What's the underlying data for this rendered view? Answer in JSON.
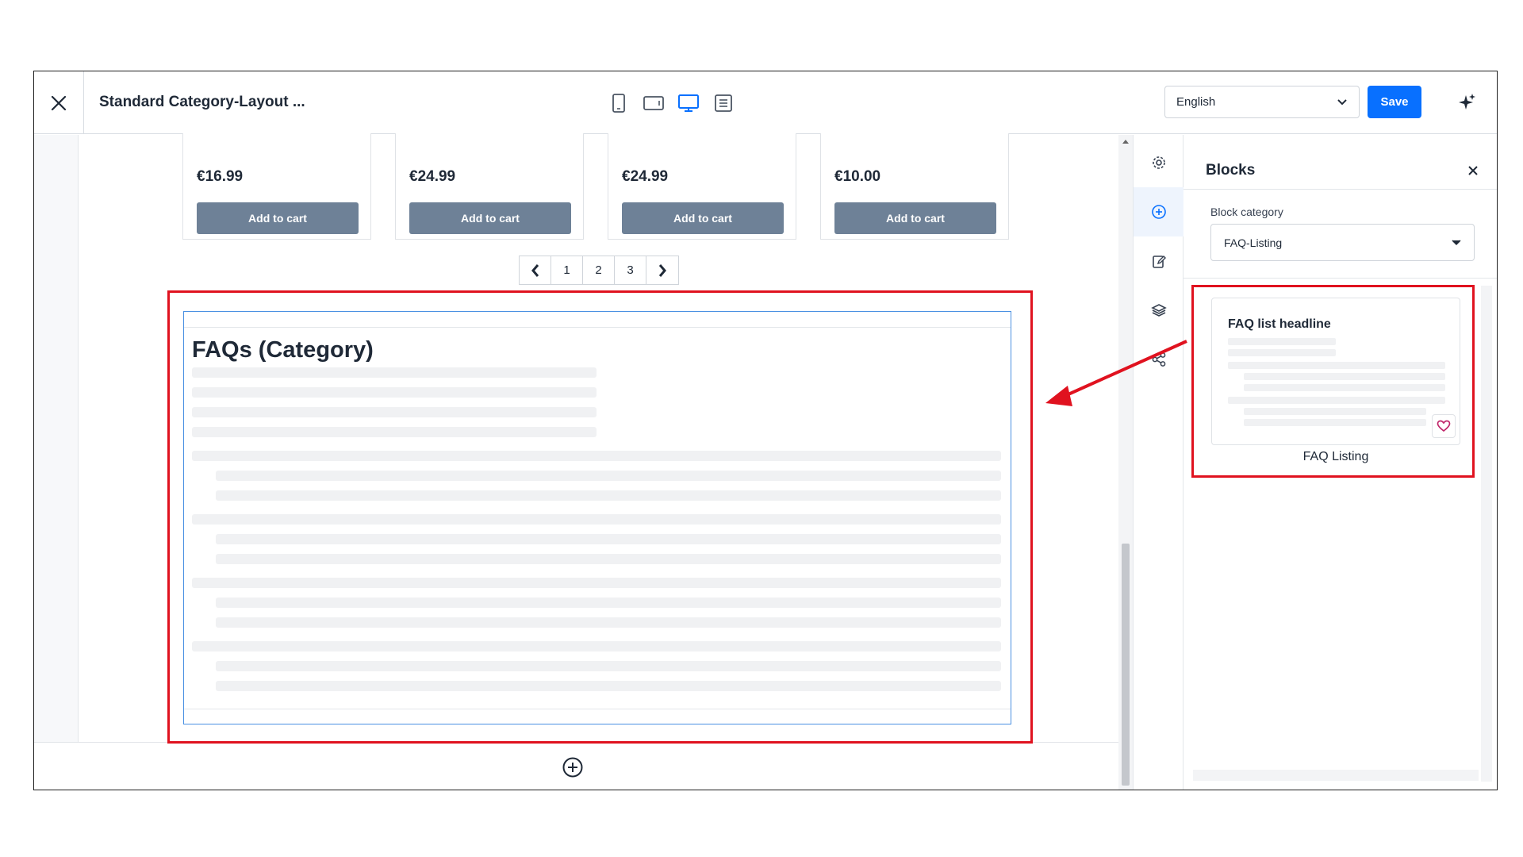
{
  "header": {
    "title": "Standard Category-Layout ...",
    "language": "English",
    "save_label": "Save"
  },
  "products": [
    {
      "price": "€16.99",
      "button": "Add to cart"
    },
    {
      "price": "€24.99",
      "button": "Add to cart"
    },
    {
      "price": "€24.99",
      "button": "Add to cart"
    },
    {
      "price": "€10.00",
      "button": "Add to cart"
    }
  ],
  "pagination": {
    "pages": [
      "1",
      "2",
      "3"
    ]
  },
  "faq_block": {
    "title": "FAQs (Category)"
  },
  "panel": {
    "title": "Blocks",
    "category_label": "Block category",
    "category_value": "FAQ-Listing",
    "card": {
      "headline": "FAQ list headline",
      "label": "FAQ Listing"
    }
  },
  "colors": {
    "accent": "#0870ff",
    "cart_button": "#6e8197",
    "annotation": "#e0121f",
    "selection": "#4a90e2"
  },
  "icons": {
    "header": [
      "close-icon",
      "mobile-icon",
      "tablet-icon",
      "desktop-icon",
      "list-view-icon",
      "chevron-down-icon",
      "sparkle-icon"
    ],
    "rail": [
      "gear-icon",
      "plus-circle-icon",
      "edit-icon",
      "layers-icon",
      "share-icon"
    ]
  }
}
